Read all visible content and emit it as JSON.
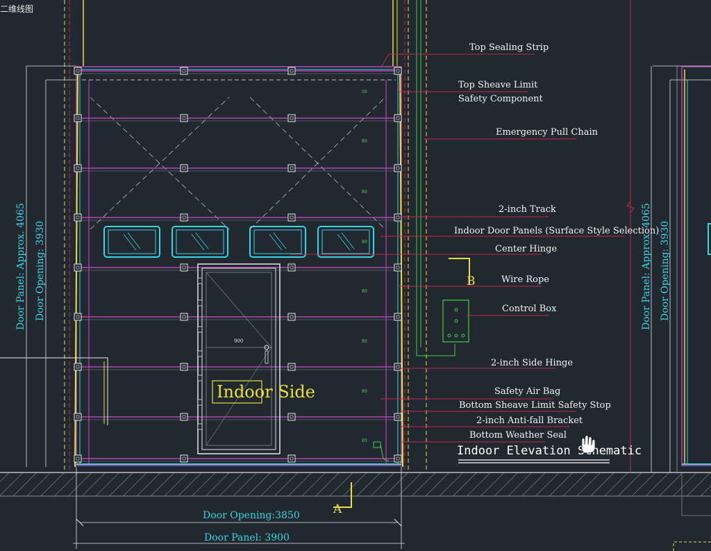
{
  "window": {
    "tab_label": "二维线图"
  },
  "title": "Indoor Elevation Schematic",
  "door_label": "Indoor Side",
  "section_markers": {
    "a": "A",
    "b": "B"
  },
  "dimensions": {
    "door_opening_width": "Door Opening:3850",
    "door_panel_width": "Door Panel: 3900",
    "door_opening_height": "Door Opening: 3930",
    "door_panel_height": "Door Panel: Approx. 4065",
    "door_opening_height_right": "Door Opening: 3930",
    "door_panel_height_right": "Door Panel: Approx. 4065",
    "pass_door_width": "900",
    "small_marks": [
      "50",
      "80",
      "80",
      "80",
      "80",
      "80",
      "80",
      "80"
    ]
  },
  "callouts": [
    {
      "id": "top-sealing-strip",
      "lines": [
        "Top Sealing Strip"
      ]
    },
    {
      "id": "top-sheave-limit",
      "lines": [
        "Top Sheave Limit",
        "Safety Component"
      ]
    },
    {
      "id": "emergency-pull-chain",
      "lines": [
        "Emergency Pull Chain"
      ]
    },
    {
      "id": "two-inch-track",
      "lines": [
        "2-inch Track"
      ]
    },
    {
      "id": "indoor-door-panels",
      "lines": [
        "Indoor Door Panels (Surface Style Selection)"
      ]
    },
    {
      "id": "center-hinge",
      "lines": [
        "Center Hinge"
      ]
    },
    {
      "id": "wire-rope",
      "lines": [
        "Wire Rope"
      ]
    },
    {
      "id": "control-box",
      "lines": [
        "Control Box"
      ]
    },
    {
      "id": "two-inch-side-hinge",
      "lines": [
        "2-inch Side Hinge"
      ]
    },
    {
      "id": "safety-air-bag",
      "lines": [
        "Safety Air Bag"
      ]
    },
    {
      "id": "bottom-sheave-limit",
      "lines": [
        "Bottom Sheave Limit Safety Stop"
      ]
    },
    {
      "id": "anti-fall-bracket",
      "lines": [
        "2-inch Anti-fall Bracket"
      ]
    },
    {
      "id": "bottom-weather-seal",
      "lines": [
        "Bottom Weather Seal"
      ]
    }
  ],
  "colors": {
    "background": "#212830",
    "panel_line": "#d04ad0",
    "frame_cyan": "#39d5e0",
    "frame_yellow": "#e8e03a",
    "leader_red": "#c8284a",
    "track_green": "#3fd13f",
    "hatch": "#8a8a8a"
  }
}
